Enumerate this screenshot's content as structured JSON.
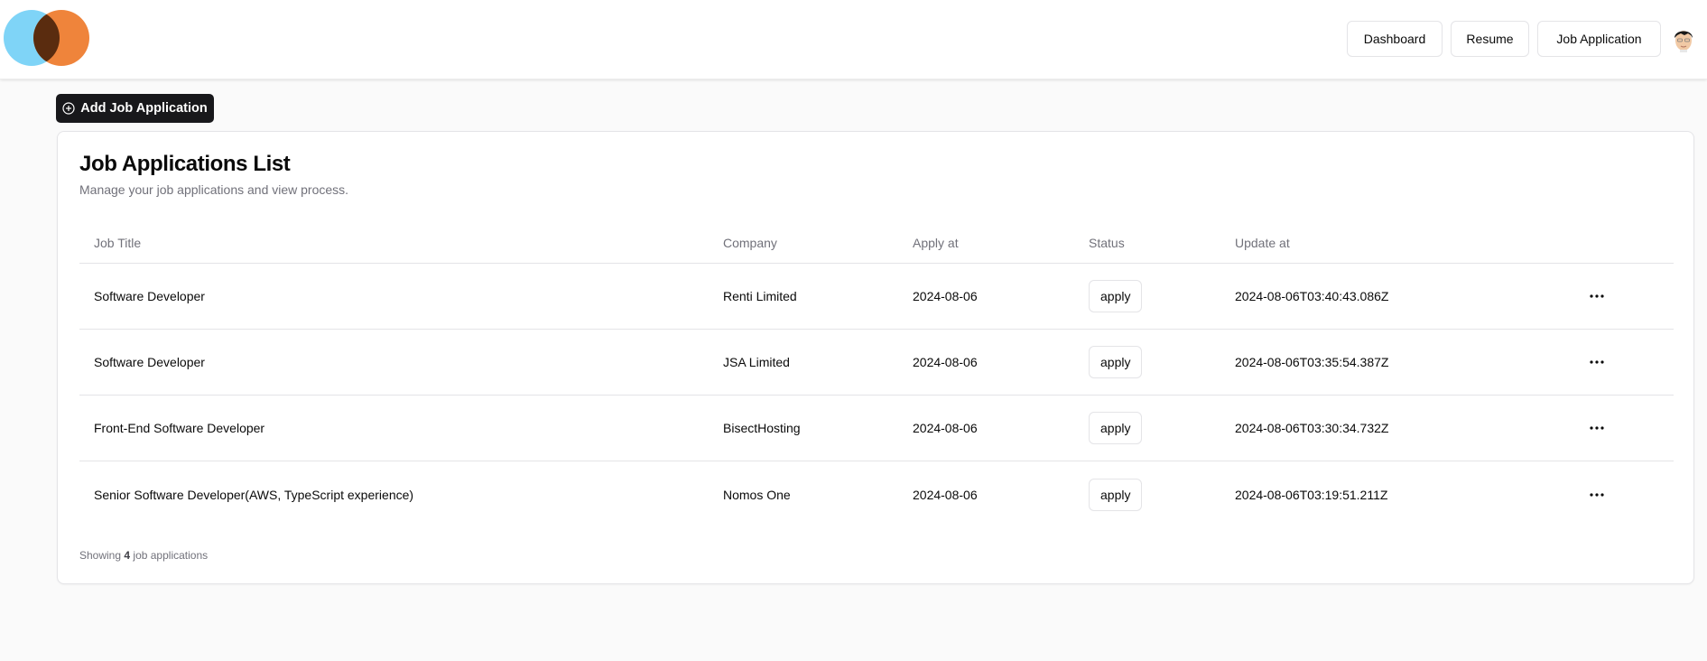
{
  "header": {
    "logo": "overlapping-circles-logo",
    "nav": [
      {
        "label": "Dashboard"
      },
      {
        "label": "Resume"
      },
      {
        "label": "Job Application"
      }
    ],
    "avatar": "user-avatar"
  },
  "colors": {
    "logo_blue": "#7fd4f7",
    "logo_orange": "#ef843b",
    "logo_overlap": "#5a2c0f",
    "primary_button": "#18181b"
  },
  "toolbar": {
    "add_label": "Add Job Application",
    "add_icon": "plus-circle-icon"
  },
  "card": {
    "title": "Job Applications List",
    "subtitle": "Manage your job applications and view process."
  },
  "table": {
    "columns": [
      "Job Title",
      "Company",
      "Apply at",
      "Status",
      "Update at"
    ],
    "rows": [
      {
        "title": "Software Developer",
        "company": "Renti Limited",
        "apply_at": "2024-08-06",
        "status": "apply",
        "update_at": "2024-08-06T03:40:43.086Z"
      },
      {
        "title": "Software Developer",
        "company": "JSA Limited",
        "apply_at": "2024-08-06",
        "status": "apply",
        "update_at": "2024-08-06T03:35:54.387Z"
      },
      {
        "title": "Front-End Software Developer",
        "company": "BisectHosting",
        "apply_at": "2024-08-06",
        "status": "apply",
        "update_at": "2024-08-06T03:30:34.732Z"
      },
      {
        "title": "Senior Software Developer(AWS, TypeScript experience)",
        "company": "Nomos One",
        "apply_at": "2024-08-06",
        "status": "apply",
        "update_at": "2024-08-06T03:19:51.211Z"
      }
    ]
  },
  "footer": {
    "prefix": "Showing",
    "count": "4",
    "suffix": "job applications"
  }
}
